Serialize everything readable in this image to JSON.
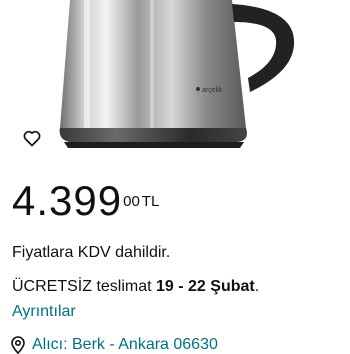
{
  "product": {
    "image_icon": "electric-kettle-image",
    "brand_mark": "arçelik"
  },
  "wishlist": {
    "icon": "heart-outline-icon"
  },
  "price": {
    "whole": "4.399",
    "fraction": "00",
    "currency": "TL"
  },
  "tax_note": "Fiyatlara KDV dahildir.",
  "delivery": {
    "prefix": "ÜCRETSİZ teslimat ",
    "dates": "19 - 22 Şubat",
    "suffix": "."
  },
  "details_link": "Ayrıntılar",
  "address": {
    "icon": "location-pin-icon",
    "text": "Alıcı: Berk - Ankara 06630"
  },
  "colors": {
    "link": "#007185",
    "text": "#0f1111"
  }
}
